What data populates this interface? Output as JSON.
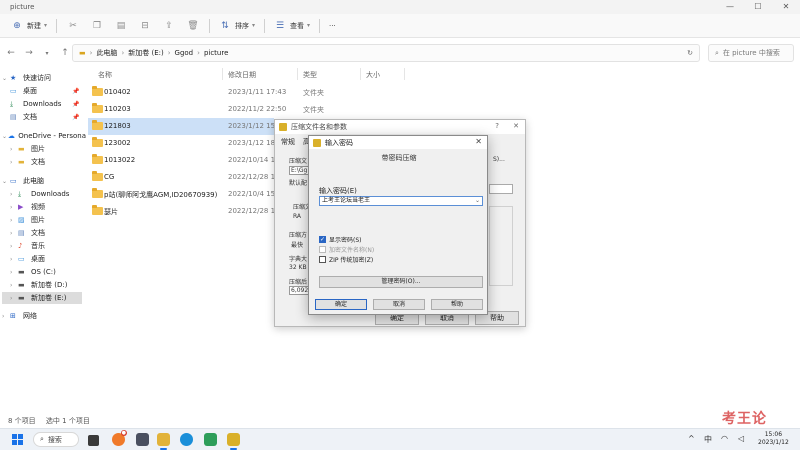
{
  "explorer": {
    "window_title": "picture",
    "window_controls": [
      "—",
      "☐",
      "✕"
    ],
    "toolbar": {
      "new_label": "新建",
      "sort_label": "排序",
      "view_label": "查看",
      "more_label": "···"
    },
    "nav": {
      "back": "←",
      "forward": "→",
      "up": "↑"
    },
    "breadcrumb": [
      "此电脑",
      "新加卷 (E:)",
      "Ggod",
      "picture"
    ],
    "search_placeholder": "在 picture 中搜索",
    "columns": {
      "name": "名称",
      "date": "修改日期",
      "type": "类型",
      "size": "大小"
    },
    "files": [
      {
        "name": "010402",
        "date": "2023/1/11 17:43",
        "type": "文件夹"
      },
      {
        "name": "110203",
        "date": "2022/11/2 22:50",
        "type": "文件夹"
      },
      {
        "name": "121803",
        "date": "2023/1/12 15:0",
        "type": "",
        "selected": true
      },
      {
        "name": "123002",
        "date": "2023/1/12 18:42",
        "type": ""
      },
      {
        "name": "1013022",
        "date": "2022/10/14 11:",
        "type": ""
      },
      {
        "name": "CG",
        "date": "2022/12/28 13:",
        "type": ""
      },
      {
        "name": "p站(聊师阿戈鹰AGM,ID20670939)",
        "date": "2022/10/4 15:4",
        "type": ""
      },
      {
        "name": "瑟片",
        "date": "2022/12/28 13:",
        "type": ""
      }
    ],
    "status": {
      "count": "8 个项目",
      "selected": "选中 1 个项目"
    }
  },
  "sidebar": {
    "items": [
      {
        "label": "快速访问",
        "icon": "star-icon"
      },
      {
        "label": "桌面",
        "icon": "desktop-icon",
        "pinned": true
      },
      {
        "label": "Downloads",
        "icon": "download-icon",
        "pinned": true
      },
      {
        "label": "文档",
        "icon": "document-icon",
        "pinned": true
      },
      {
        "label": "OneDrive - Persona",
        "icon": "cloud-icon"
      },
      {
        "label": "图片",
        "icon": "folder-icon"
      },
      {
        "label": "文档",
        "icon": "folder-icon"
      },
      {
        "label": "此电脑",
        "icon": "computer-icon"
      },
      {
        "label": "Downloads",
        "icon": "download-icon"
      },
      {
        "label": "视频",
        "icon": "video-icon"
      },
      {
        "label": "图片",
        "icon": "picture-icon"
      },
      {
        "label": "文档",
        "icon": "document-icon"
      },
      {
        "label": "音乐",
        "icon": "music-icon"
      },
      {
        "label": "桌面",
        "icon": "desktop-icon"
      },
      {
        "label": "OS (C:)",
        "icon": "drive-icon"
      },
      {
        "label": "新加卷 (D:)",
        "icon": "drive-icon"
      },
      {
        "label": "新加卷 (E:)",
        "icon": "drive-icon",
        "selected": true
      },
      {
        "label": "网络",
        "icon": "network-icon"
      }
    ]
  },
  "compress_dialog": {
    "title": "压缩文件名和参数",
    "help": "?",
    "close": "✕",
    "tab_general": "常规",
    "tab_adv": "高",
    "fragments": [
      "压缩文",
      "E:\\Gg",
      "默认配",
      "压缩文",
      "RA",
      "压缩方",
      "最快",
      "字典大",
      "32 KB",
      "压缩后",
      "6,092",
      "S)...",
      "确定",
      "取消",
      "帮助"
    ]
  },
  "password_dialog": {
    "title": "输入密码",
    "close": "✕",
    "subtitle": "带密码压缩",
    "label": "输入密码(E)",
    "value": "上考王论坛当老王",
    "checkboxes": [
      {
        "label": "显示密码(S)",
        "checked": true,
        "disabled": false
      },
      {
        "label": "加密文件名称(N)",
        "checked": false,
        "disabled": true
      },
      {
        "label": "ZIP 传统加密(Z)",
        "checked": false,
        "disabled": false
      }
    ],
    "manage_label": "管理密码(O)...",
    "ok_label": "确定",
    "cancel_label": "取消",
    "help_label": "帮助"
  },
  "watermark": "考王论",
  "taskbar": {
    "search_label": "搜索",
    "tray": {
      "chevron": "^",
      "ime": "中",
      "wifi": "◠",
      "volume": "◁"
    },
    "time": "15:06",
    "date": "2023/1/12"
  },
  "colors": {
    "accent": "#2a66c4",
    "folder": "#f4c24e",
    "selection": "#cce0f7"
  }
}
